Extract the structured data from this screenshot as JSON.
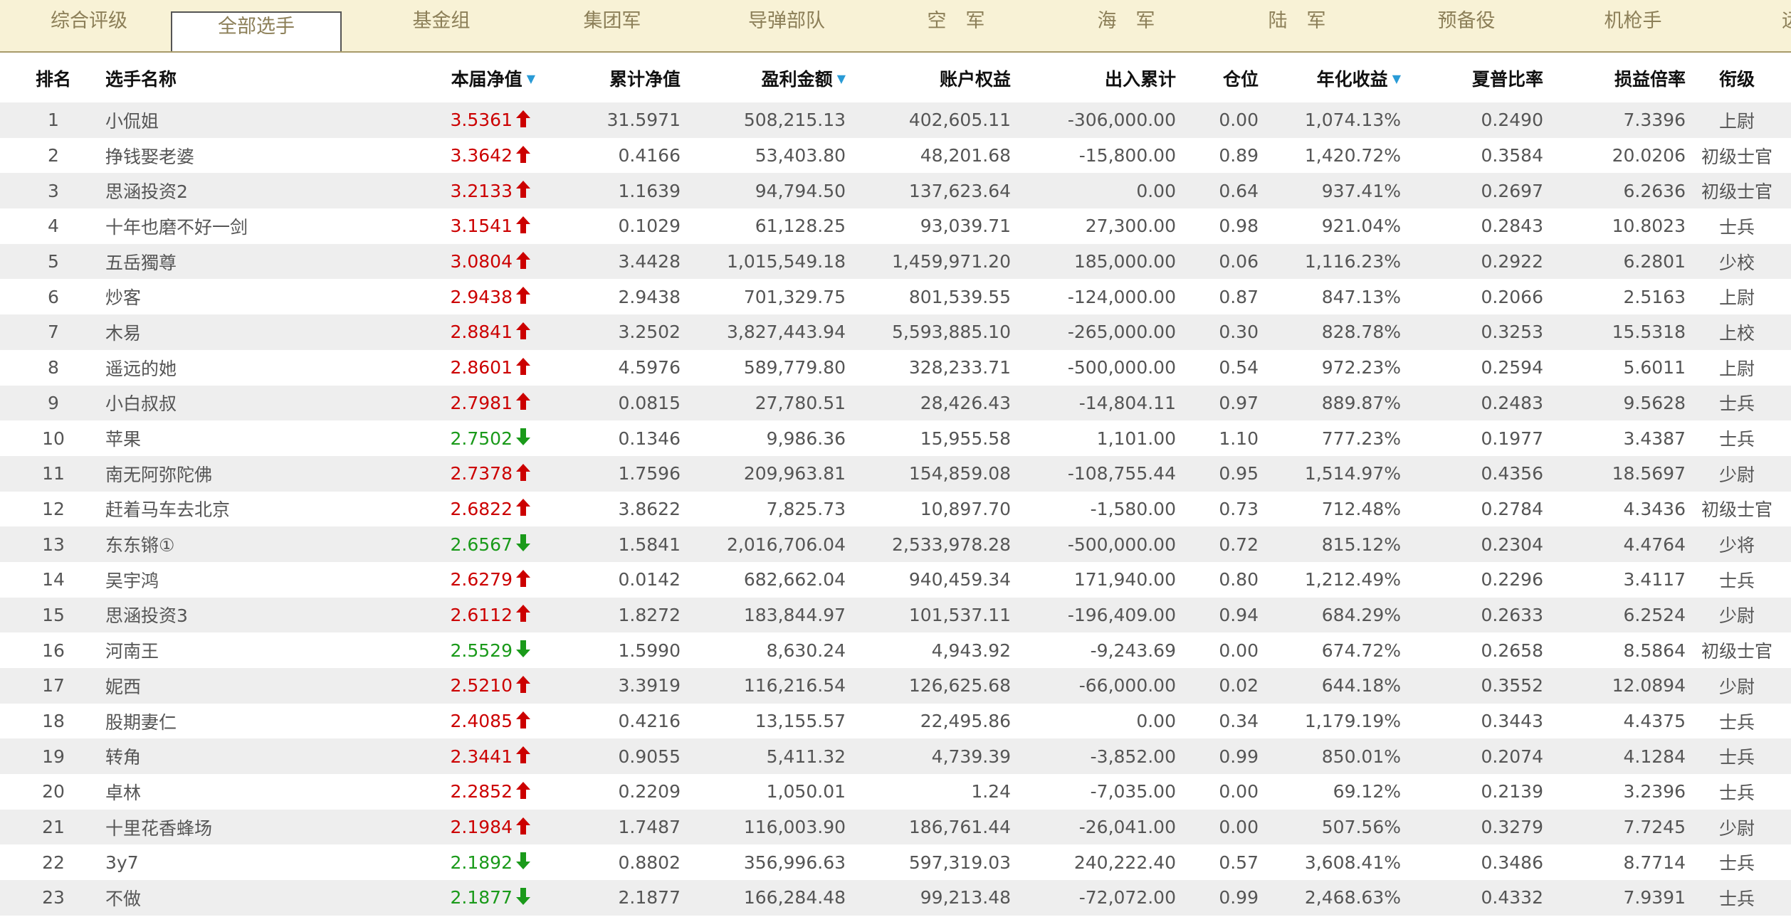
{
  "tabs": [
    {
      "label": "综合评级"
    },
    {
      "label": "全部选手",
      "active": true
    },
    {
      "label": "基金组"
    },
    {
      "label": "集团军"
    },
    {
      "label": "导弹部队"
    },
    {
      "label": "空　军"
    },
    {
      "label": "海　军"
    },
    {
      "label": "陆　军"
    },
    {
      "label": "预备役"
    },
    {
      "label": "机枪手"
    },
    {
      "label": "远征"
    }
  ],
  "columns": {
    "rank": "排名",
    "name": "选手名称",
    "nav": "本届净值",
    "cum": "累计净值",
    "profit": "盈利金额",
    "equity": "账户权益",
    "flow": "出入累计",
    "position": "仓位",
    "annual": "年化收益",
    "sharpe": "夏普比率",
    "pl": "损益倍率",
    "title": "衔级"
  },
  "sort_icon": "triangle-down",
  "colors": {
    "up": "#cc0000",
    "down": "#1a9a1a",
    "sort": "#2a9bd6"
  },
  "rows": [
    {
      "rank": "1",
      "name": "小侃姐",
      "nav": "3.5361",
      "dir": "up",
      "cum": "31.5971",
      "profit": "508,215.13",
      "equity": "402,605.11",
      "flow": "-306,000.00",
      "position": "0.00",
      "annual": "1,074.13%",
      "sharpe": "0.2490",
      "pl": "7.3396",
      "title": "上尉"
    },
    {
      "rank": "2",
      "name": "挣钱娶老婆",
      "nav": "3.3642",
      "dir": "up",
      "cum": "0.4166",
      "profit": "53,403.80",
      "equity": "48,201.68",
      "flow": "-15,800.00",
      "position": "0.89",
      "annual": "1,420.72%",
      "sharpe": "0.3584",
      "pl": "20.0206",
      "title": "初级士官"
    },
    {
      "rank": "3",
      "name": "思涵投资2",
      "nav": "3.2133",
      "dir": "up",
      "cum": "1.1639",
      "profit": "94,794.50",
      "equity": "137,623.64",
      "flow": "0.00",
      "position": "0.64",
      "annual": "937.41%",
      "sharpe": "0.2697",
      "pl": "6.2636",
      "title": "初级士官"
    },
    {
      "rank": "4",
      "name": "十年也磨不好一剑",
      "nav": "3.1541",
      "dir": "up",
      "cum": "0.1029",
      "profit": "61,128.25",
      "equity": "93,039.71",
      "flow": "27,300.00",
      "position": "0.98",
      "annual": "921.04%",
      "sharpe": "0.2843",
      "pl": "10.8023",
      "title": "士兵"
    },
    {
      "rank": "5",
      "name": "五岳獨尊",
      "nav": "3.0804",
      "dir": "up",
      "cum": "3.4428",
      "profit": "1,015,549.18",
      "equity": "1,459,971.20",
      "flow": "185,000.00",
      "position": "0.06",
      "annual": "1,116.23%",
      "sharpe": "0.2922",
      "pl": "6.2801",
      "title": "少校"
    },
    {
      "rank": "6",
      "name": "炒客",
      "nav": "2.9438",
      "dir": "up",
      "cum": "2.9438",
      "profit": "701,329.75",
      "equity": "801,539.55",
      "flow": "-124,000.00",
      "position": "0.87",
      "annual": "847.13%",
      "sharpe": "0.2066",
      "pl": "2.5163",
      "title": "上尉"
    },
    {
      "rank": "7",
      "name": "木易",
      "nav": "2.8841",
      "dir": "up",
      "cum": "3.2502",
      "profit": "3,827,443.94",
      "equity": "5,593,885.10",
      "flow": "-265,000.00",
      "position": "0.30",
      "annual": "828.78%",
      "sharpe": "0.3253",
      "pl": "15.5318",
      "title": "上校"
    },
    {
      "rank": "8",
      "name": "遥远的她",
      "nav": "2.8601",
      "dir": "up",
      "cum": "4.5976",
      "profit": "589,779.80",
      "equity": "328,233.71",
      "flow": "-500,000.00",
      "position": "0.54",
      "annual": "972.23%",
      "sharpe": "0.2594",
      "pl": "5.6011",
      "title": "上尉"
    },
    {
      "rank": "9",
      "name": "小白叔叔",
      "nav": "2.7981",
      "dir": "up",
      "cum": "0.0815",
      "profit": "27,780.51",
      "equity": "28,426.43",
      "flow": "-14,804.11",
      "position": "0.97",
      "annual": "889.87%",
      "sharpe": "0.2483",
      "pl": "9.5628",
      "title": "士兵"
    },
    {
      "rank": "10",
      "name": "苹果",
      "nav": "2.7502",
      "dir": "down",
      "cum": "0.1346",
      "profit": "9,986.36",
      "equity": "15,955.58",
      "flow": "1,101.00",
      "position": "1.10",
      "annual": "777.23%",
      "sharpe": "0.1977",
      "pl": "3.4387",
      "title": "士兵"
    },
    {
      "rank": "11",
      "name": "南无阿弥陀佛",
      "nav": "2.7378",
      "dir": "up",
      "cum": "1.7596",
      "profit": "209,963.81",
      "equity": "154,859.08",
      "flow": "-108,755.44",
      "position": "0.95",
      "annual": "1,514.97%",
      "sharpe": "0.4356",
      "pl": "18.5697",
      "title": "少尉"
    },
    {
      "rank": "12",
      "name": "赶着马车去北京",
      "nav": "2.6822",
      "dir": "up",
      "cum": "3.8622",
      "profit": "7,825.73",
      "equity": "10,897.70",
      "flow": "-1,580.00",
      "position": "0.73",
      "annual": "712.48%",
      "sharpe": "0.2784",
      "pl": "4.3436",
      "title": "初级士官"
    },
    {
      "rank": "13",
      "name": "东东锵①",
      "nav": "2.6567",
      "dir": "down",
      "cum": "1.5841",
      "profit": "2,016,706.04",
      "equity": "2,533,978.28",
      "flow": "-500,000.00",
      "position": "0.72",
      "annual": "815.12%",
      "sharpe": "0.2304",
      "pl": "4.4764",
      "title": "少将"
    },
    {
      "rank": "14",
      "name": "吴宇鸿",
      "nav": "2.6279",
      "dir": "up",
      "cum": "0.0142",
      "profit": "682,662.04",
      "equity": "940,459.34",
      "flow": "171,940.00",
      "position": "0.80",
      "annual": "1,212.49%",
      "sharpe": "0.2296",
      "pl": "3.4117",
      "title": "士兵"
    },
    {
      "rank": "15",
      "name": "思涵投资3",
      "nav": "2.6112",
      "dir": "up",
      "cum": "1.8272",
      "profit": "183,844.97",
      "equity": "101,537.11",
      "flow": "-196,409.00",
      "position": "0.94",
      "annual": "684.29%",
      "sharpe": "0.2633",
      "pl": "6.2524",
      "title": "少尉"
    },
    {
      "rank": "16",
      "name": "河南王",
      "nav": "2.5529",
      "dir": "down",
      "cum": "1.5990",
      "profit": "8,630.24",
      "equity": "4,943.92",
      "flow": "-9,243.69",
      "position": "0.00",
      "annual": "674.72%",
      "sharpe": "0.2658",
      "pl": "8.5864",
      "title": "初级士官"
    },
    {
      "rank": "17",
      "name": "妮西",
      "nav": "2.5210",
      "dir": "up",
      "cum": "3.3919",
      "profit": "116,216.54",
      "equity": "126,625.68",
      "flow": "-66,000.00",
      "position": "0.02",
      "annual": "644.18%",
      "sharpe": "0.3552",
      "pl": "12.0894",
      "title": "少尉"
    },
    {
      "rank": "18",
      "name": "股期妻仁",
      "nav": "2.4085",
      "dir": "up",
      "cum": "0.4216",
      "profit": "13,155.57",
      "equity": "22,495.86",
      "flow": "0.00",
      "position": "0.34",
      "annual": "1,179.19%",
      "sharpe": "0.3443",
      "pl": "4.4375",
      "title": "士兵"
    },
    {
      "rank": "19",
      "name": "转角",
      "nav": "2.3441",
      "dir": "up",
      "cum": "0.9055",
      "profit": "5,411.32",
      "equity": "4,739.39",
      "flow": "-3,852.00",
      "position": "0.99",
      "annual": "850.01%",
      "sharpe": "0.2074",
      "pl": "4.1284",
      "title": "士兵"
    },
    {
      "rank": "20",
      "name": "卓林",
      "nav": "2.2852",
      "dir": "up",
      "cum": "0.2209",
      "profit": "1,050.01",
      "equity": "1.24",
      "flow": "-7,035.00",
      "position": "0.00",
      "annual": "69.12%",
      "sharpe": "0.2139",
      "pl": "3.2396",
      "title": "士兵"
    },
    {
      "rank": "21",
      "name": "十里花香蜂场",
      "nav": "2.1984",
      "dir": "up",
      "cum": "1.7487",
      "profit": "116,003.90",
      "equity": "186,761.44",
      "flow": "-26,041.00",
      "position": "0.00",
      "annual": "507.56%",
      "sharpe": "0.3279",
      "pl": "7.7245",
      "title": "少尉"
    },
    {
      "rank": "22",
      "name": "3y7",
      "nav": "2.1892",
      "dir": "down",
      "cum": "0.8802",
      "profit": "356,996.63",
      "equity": "597,319.03",
      "flow": "240,222.40",
      "position": "0.57",
      "annual": "3,608.41%",
      "sharpe": "0.3486",
      "pl": "8.7714",
      "title": "士兵"
    },
    {
      "rank": "23",
      "name": "不做",
      "nav": "2.1877",
      "dir": "down",
      "cum": "2.1877",
      "profit": "166,284.48",
      "equity": "99,213.48",
      "flow": "-72,072.00",
      "position": "0.99",
      "annual": "2,468.63%",
      "sharpe": "0.4332",
      "pl": "7.9391",
      "title": "士兵"
    }
  ]
}
